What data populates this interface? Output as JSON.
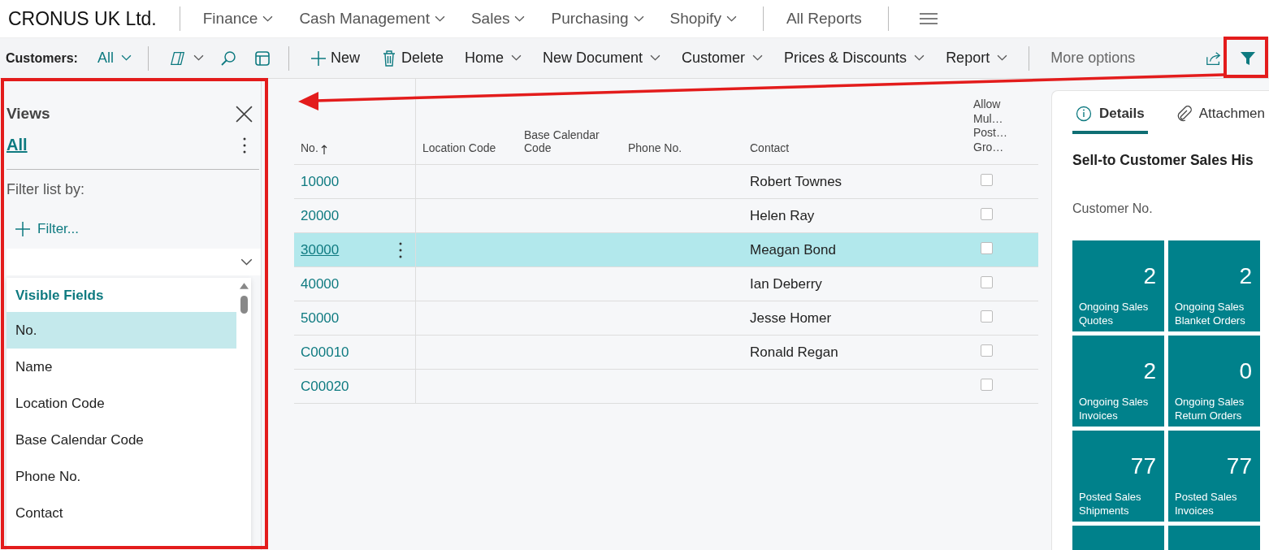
{
  "company": "CRONUS UK Ltd.",
  "nav": [
    {
      "label": "Finance",
      "kind": "menu"
    },
    {
      "label": "Cash Management",
      "kind": "menu"
    },
    {
      "label": "Sales",
      "kind": "menu"
    },
    {
      "label": "Purchasing",
      "kind": "menu"
    },
    {
      "label": "Shopify",
      "kind": "menu"
    },
    {
      "label": "All Reports",
      "kind": "link"
    }
  ],
  "toolbar": {
    "page_label": "Customers:",
    "view": "All",
    "actions": [
      {
        "label": "New",
        "kind": "new"
      },
      {
        "label": "Delete",
        "kind": "delete"
      },
      {
        "label": "Home",
        "kind": "menu"
      },
      {
        "label": "New Document",
        "kind": "menu"
      },
      {
        "label": "Customer",
        "kind": "menu"
      },
      {
        "label": "Prices & Discounts",
        "kind": "menu"
      },
      {
        "label": "Report",
        "kind": "menu"
      }
    ],
    "more": "More options"
  },
  "filter_pane": {
    "title": "Views",
    "view_link": "All",
    "filter_heading": "Filter list by:",
    "add_filter": "Filter...",
    "dropdown": {
      "group": "Visible Fields",
      "items": [
        {
          "label": "No.",
          "selected": true
        },
        {
          "label": "Name",
          "selected": false
        },
        {
          "label": "Location Code",
          "selected": false
        },
        {
          "label": "Base Calendar Code",
          "selected": false
        },
        {
          "label": "Phone No.",
          "selected": false
        },
        {
          "label": "Contact",
          "selected": false
        }
      ]
    }
  },
  "table": {
    "columns": [
      {
        "label": "No.",
        "sorted": true
      },
      {
        "label": "Location Code",
        "sorted": false
      },
      {
        "label": "Base Calendar Code",
        "sorted": false
      },
      {
        "label": "Phone No.",
        "sorted": false
      },
      {
        "label": "Contact",
        "sorted": false
      },
      {
        "label": "Allow Mul… Post… Gro…",
        "sorted": false
      }
    ],
    "rows": [
      {
        "no": "10000",
        "contact": "Robert Townes",
        "allow": false,
        "selected": false
      },
      {
        "no": "20000",
        "contact": "Helen Ray",
        "allow": false,
        "selected": false
      },
      {
        "no": "30000",
        "contact": "Meagan Bond",
        "allow": false,
        "selected": true
      },
      {
        "no": "40000",
        "contact": "Ian Deberry",
        "allow": false,
        "selected": false
      },
      {
        "no": "50000",
        "contact": "Jesse Homer",
        "allow": false,
        "selected": false
      },
      {
        "no": "C00010",
        "contact": "Ronald Regan",
        "allow": false,
        "selected": false
      },
      {
        "no": "C00020",
        "allow": false,
        "selected": false
      }
    ]
  },
  "factbox": {
    "tabs": [
      {
        "label": "Details",
        "kind": "info",
        "selected": true
      },
      {
        "label": "Attachmen",
        "kind": "attach",
        "selected": false
      }
    ],
    "heading": "Sell-to Customer Sales His",
    "field_label": "Customer No.",
    "tiles": [
      {
        "kind": "full",
        "value": "2",
        "label": "Ongoing Sales Quotes"
      },
      {
        "kind": "full",
        "value": "2",
        "label": "Ongoing Sales Blanket Orders"
      },
      {
        "kind": "full",
        "value": "2",
        "label": "Ongoing Sales Invoices"
      },
      {
        "kind": "full",
        "value": "0",
        "label": "Ongoing Sales Return Orders"
      },
      {
        "kind": "full",
        "value": "77",
        "label": "Posted Sales Shipments"
      },
      {
        "kind": "full",
        "value": "77",
        "label": "Posted Sales Invoices"
      },
      {
        "kind": "cut"
      },
      {
        "kind": "cut"
      }
    ]
  },
  "annotations": {
    "frame_filter_pane": true,
    "frame_filter_button": true,
    "arrow": true
  }
}
